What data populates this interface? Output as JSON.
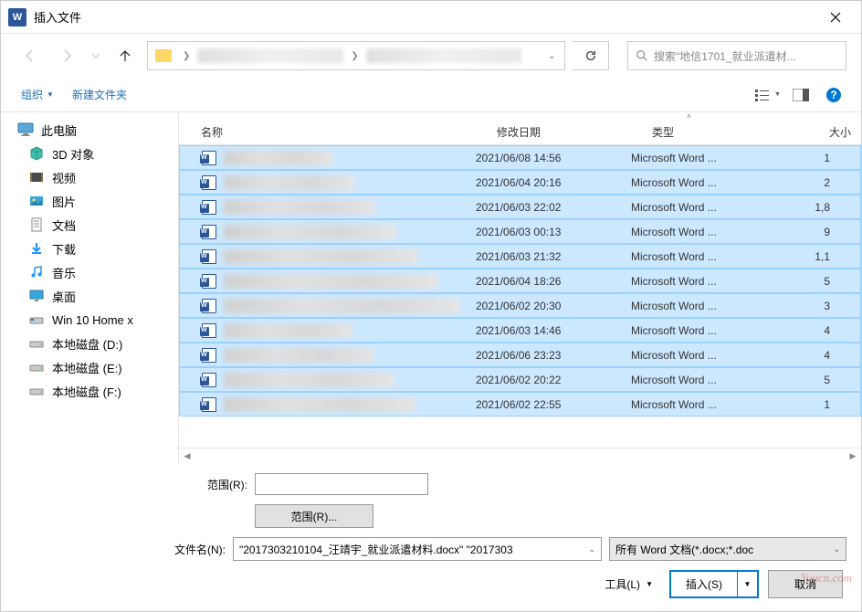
{
  "window": {
    "title": "插入文件",
    "app_icon_letter": "W"
  },
  "nav": {
    "search_placeholder": "搜索\"地信1701_就业派遣材..."
  },
  "toolbar": {
    "organize": "组织",
    "new_folder": "新建文件夹"
  },
  "sidebar": {
    "this_pc": "此电脑",
    "items": [
      {
        "label": "3D 对象",
        "icon": "3d"
      },
      {
        "label": "视频",
        "icon": "video"
      },
      {
        "label": "图片",
        "icon": "pictures"
      },
      {
        "label": "文档",
        "icon": "documents"
      },
      {
        "label": "下载",
        "icon": "downloads"
      },
      {
        "label": "音乐",
        "icon": "music"
      },
      {
        "label": "桌面",
        "icon": "desktop"
      },
      {
        "label": "Win 10 Home x",
        "icon": "osdrive"
      },
      {
        "label": "本地磁盘 (D:)",
        "icon": "drive"
      },
      {
        "label": "本地磁盘 (E:)",
        "icon": "drive"
      },
      {
        "label": "本地磁盘 (F:)",
        "icon": "drive"
      }
    ]
  },
  "columns": {
    "name": "名称",
    "date": "修改日期",
    "type": "类型",
    "size": "大小"
  },
  "files": [
    {
      "date": "2021/06/08 14:56",
      "type": "Microsoft Word ...",
      "size": "1"
    },
    {
      "date": "2021/06/04 20:16",
      "type": "Microsoft Word ...",
      "size": "2"
    },
    {
      "date": "2021/06/03 22:02",
      "type": "Microsoft Word ...",
      "size": "1,8"
    },
    {
      "date": "2021/06/03 00:13",
      "type": "Microsoft Word ...",
      "size": "9"
    },
    {
      "date": "2021/06/03 21:32",
      "type": "Microsoft Word ...",
      "size": "1,1"
    },
    {
      "date": "2021/06/04 18:26",
      "type": "Microsoft Word ...",
      "size": "5"
    },
    {
      "date": "2021/06/02 20:30",
      "type": "Microsoft Word ...",
      "size": "3"
    },
    {
      "date": "2021/06/03 14:46",
      "type": "Microsoft Word ...",
      "size": "4"
    },
    {
      "date": "2021/06/06 23:23",
      "type": "Microsoft Word ...",
      "size": "4"
    },
    {
      "date": "2021/06/02 20:22",
      "type": "Microsoft Word ...",
      "size": "5"
    },
    {
      "date": "2021/06/02 22:55",
      "type": "Microsoft Word ...",
      "size": "1"
    }
  ],
  "footer": {
    "range_label": "范围(R):",
    "range_button": "范围(R)...",
    "filename_label": "文件名(N):",
    "filename_value": "\"2017303210104_汪靖宇_就业派遣材料.docx\" \"2017303",
    "filetype_value": "所有 Word 文档(*.docx;*.doc",
    "tools_label": "工具(L)",
    "insert_label": "插入(S)",
    "cancel_label": "取消"
  },
  "watermark": "Yuucn.com"
}
